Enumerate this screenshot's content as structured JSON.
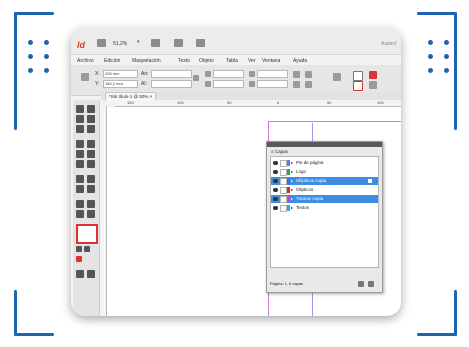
{
  "window": {
    "title_partial": "Aspect"
  },
  "app": {
    "logo_text": "Id",
    "zoom": "51,2%"
  },
  "menu": {
    "items": [
      "Archivo",
      "Edición",
      "Maquetación",
      "Texto",
      "Objeto",
      "Tabla",
      "Ver",
      "Ventana",
      "Ayuda"
    ]
  },
  "control": {
    "x_label": "X:",
    "x_value": "200 mm",
    "y_label": "Y:",
    "y_value": "184,2 mm",
    "w_label": "An:",
    "h_label": "Al:"
  },
  "document": {
    "tab_label": "*Sin título-1 @ 50% ×"
  },
  "ruler": {
    "labels": [
      "150",
      "100",
      "50",
      "0",
      "50",
      "100"
    ]
  },
  "layers_panel": {
    "title": "≡ Capas",
    "layers": [
      {
        "name": "Pie de página",
        "color": "#5a7de0",
        "selected": false
      },
      {
        "name": "Logo",
        "color": "#2ea34a",
        "selected": false
      },
      {
        "name": "Ullipticos copia",
        "color": "#3b6ee8",
        "selected": true
      },
      {
        "name": "Olipticos",
        "color": "#d02e2e",
        "selected": false
      },
      {
        "name": "Tramas copia",
        "color": "#e040c8",
        "selected": true
      },
      {
        "name": "Textos",
        "color": "#45a0e0",
        "selected": false
      }
    ],
    "footer": "Página: 1, 6 capas"
  },
  "colors": {
    "frame": "#1f64b4",
    "selection": "#3d8ee3",
    "logo": "#d9402b"
  }
}
